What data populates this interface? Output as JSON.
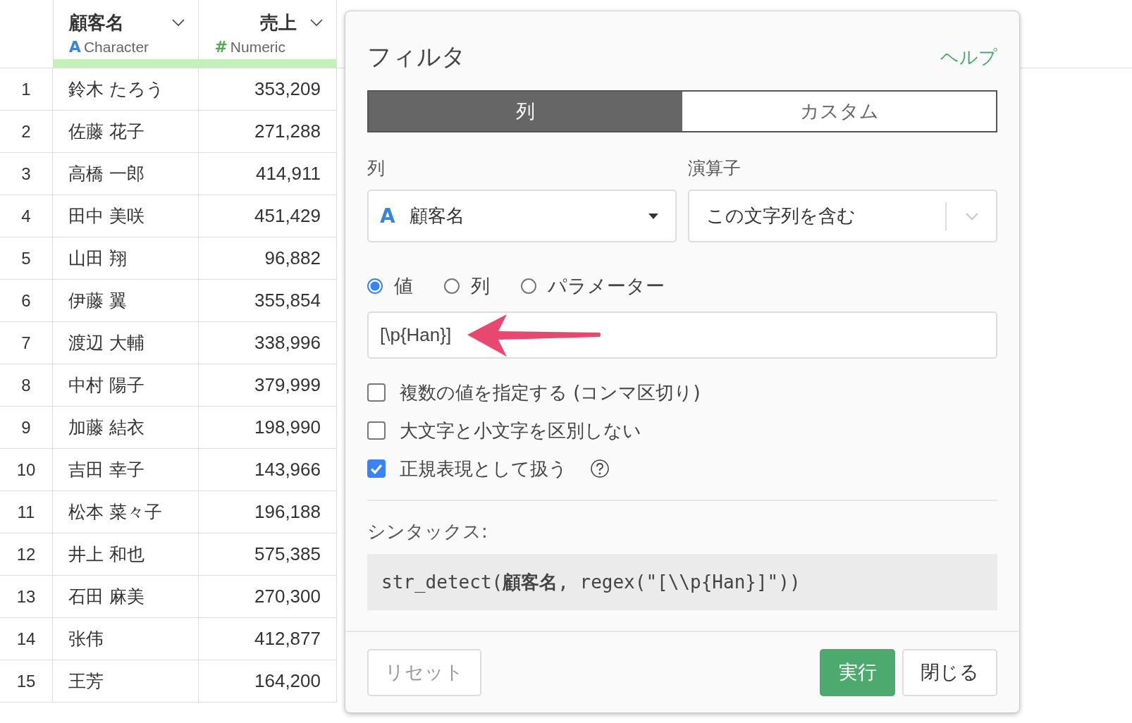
{
  "table": {
    "columns": [
      {
        "name": "顧客名",
        "type": "Character",
        "kind": "character",
        "type_icon": "A"
      },
      {
        "name": "売上",
        "type": "Numeric",
        "kind": "numeric",
        "type_icon": "#"
      }
    ],
    "rows": [
      {
        "index": "1",
        "cells": [
          "鈴木 たろう",
          "353,209"
        ]
      },
      {
        "index": "2",
        "cells": [
          "佐藤 花子",
          "271,288"
        ]
      },
      {
        "index": "3",
        "cells": [
          "高橋 一郎",
          "414,911"
        ]
      },
      {
        "index": "4",
        "cells": [
          "田中 美咲",
          "451,429"
        ]
      },
      {
        "index": "5",
        "cells": [
          "山田 翔",
          "96,882"
        ]
      },
      {
        "index": "6",
        "cells": [
          "伊藤 翼",
          "355,854"
        ]
      },
      {
        "index": "7",
        "cells": [
          "渡辺 大輔",
          "338,996"
        ]
      },
      {
        "index": "8",
        "cells": [
          "中村 陽子",
          "379,999"
        ]
      },
      {
        "index": "9",
        "cells": [
          "加藤 結衣",
          "198,990"
        ]
      },
      {
        "index": "10",
        "cells": [
          "吉田 幸子",
          "143,966"
        ]
      },
      {
        "index": "11",
        "cells": [
          "松本 菜々子",
          "196,188"
        ]
      },
      {
        "index": "12",
        "cells": [
          "井上 和也",
          "575,385"
        ]
      },
      {
        "index": "13",
        "cells": [
          "石田 麻美",
          "270,300"
        ]
      },
      {
        "index": "14",
        "cells": [
          "张伟",
          "412,877"
        ]
      },
      {
        "index": "15",
        "cells": [
          "王芳",
          "164,200"
        ]
      }
    ]
  },
  "dialog": {
    "title": "フィルタ",
    "help_link": "ヘルプ",
    "tabs": [
      {
        "label": "列",
        "selected": true
      },
      {
        "label": "カスタム",
        "selected": false
      }
    ],
    "column_label": "列",
    "column_select": {
      "icon": "A",
      "value": "顧客名"
    },
    "operator_label": "演算子",
    "operator_select": {
      "value": "この文字列を含む"
    },
    "value_types": [
      {
        "label": "値",
        "selected": true
      },
      {
        "label": "列",
        "selected": false
      },
      {
        "label": "パラメーター",
        "selected": false
      }
    ],
    "value_input": {
      "value": "[\\p{Han}]"
    },
    "options": [
      {
        "label": "複数の値を指定する (コンマ区切り)",
        "checked": false,
        "help": false
      },
      {
        "label": "大文字と小文字を区別しない",
        "checked": false,
        "help": false
      },
      {
        "label": "正規表現として扱う",
        "checked": true,
        "help": true
      }
    ],
    "syntax_label": "シンタックス:",
    "syntax": "str_detect(**顧客名**, regex(\"[\\\\p{Han}]\"))",
    "buttons": {
      "reset": "リセット",
      "run": "実行",
      "close": "閉じる"
    }
  }
}
